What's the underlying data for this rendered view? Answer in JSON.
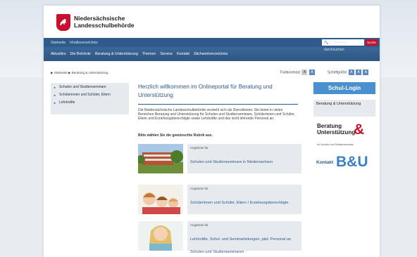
{
  "header": {
    "org_line1": "Niedersächsische",
    "org_line2": "Landesschulbehörde"
  },
  "topbar": {
    "links": [
      "Startseite",
      "Inhaltsverzeichnis"
    ],
    "search_placeholder": "Website durchsuchen",
    "search_button": "Suche"
  },
  "nav": {
    "items": [
      "Aktuelles",
      "Die Behörde",
      "Beratung & Unterstützung",
      "Themen",
      "Service",
      "Kontakt",
      "Stichwortverzeichnis"
    ]
  },
  "breadcrumb": {
    "items": [
      "Startseite",
      "Beratung & Unterstützung"
    ]
  },
  "font_controls": {
    "contrast_label": "Farbkontrast",
    "size_label": "Schriftgröße",
    "contrast_a": "A",
    "contrast_b": "A",
    "sizes": [
      "A",
      "A",
      "A"
    ]
  },
  "sidebar": {
    "items": [
      "Schulen und Studienseminare",
      "Schülerinnen und Schüler, Eltern",
      "Lehrkräfte"
    ]
  },
  "main": {
    "title": "Herzlich willkommen im Onlineportal für Beratung und Unterstützung",
    "intro": "Die Niedersächsische Landesschulbehörde versteht sich als Dienstleister. Sie bietet in vielen Bereichen Beratung und Unterstützung für Schulen und Studienseminare, Schülerinnen und Schüler, Eltern und Erziehungsberechtigte sowie Lehrkräfte und das nicht lehrende Personal an.",
    "choose": "Bitte wählen Sie die gewünschte Rubrik aus.",
    "cards": [
      {
        "kicker": "Angebote für",
        "link": "Schulen und Studienseminare in Niedersachsen"
      },
      {
        "kicker": "Angebote für",
        "link": "Schülerinnen und Schüler, Eltern / Erziehungsberechtigte"
      },
      {
        "kicker": "Angebote für",
        "link": "Lehrkräfte, Schul- und Seminarleitungen, päd. Personal an Schulen und Studienseminaren"
      }
    ]
  },
  "right": {
    "login": "Schul-Login",
    "beratung_box": "Beratung & Unterstützung",
    "beratung_logo_line1": "Beratung",
    "beratung_logo_line2": "Unterstützung",
    "beratung_logo_amp": "&",
    "beratung_logo_sub": "für Schulen und Studienseminare",
    "kontakt": "Kontakt",
    "bu": "B&U"
  },
  "colors": {
    "brand_red": "#c8102e",
    "nav_blue": "#2f5a8a",
    "accent_blue": "#4a90d0"
  }
}
